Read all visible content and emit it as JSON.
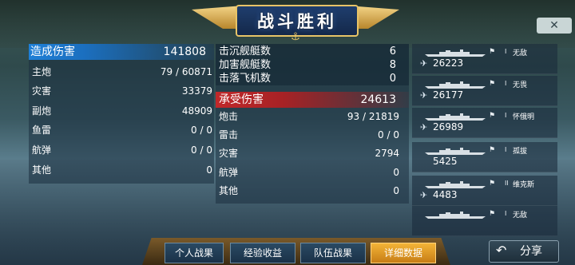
{
  "banner": {
    "title": "战斗胜利"
  },
  "close": {
    "symbol": "✕"
  },
  "damage_dealt": {
    "label": "造成伤害",
    "total": "141808",
    "rows": [
      {
        "label": "主炮",
        "value": "79 / 60871"
      },
      {
        "label": "灾害",
        "value": "33379"
      },
      {
        "label": "副炮",
        "value": "48909"
      },
      {
        "label": "鱼雷",
        "value": "0 / 0"
      },
      {
        "label": "航弹",
        "value": "0 / 0"
      },
      {
        "label": "其他",
        "value": "0"
      }
    ]
  },
  "kills": [
    {
      "label": "击沉舰艇数",
      "value": "6"
    },
    {
      "label": "加害舰艇数",
      "value": "8"
    },
    {
      "label": "击落飞机数",
      "value": "0"
    }
  ],
  "damage_received": {
    "label": "承受伤害",
    "total": "24613",
    "rows": [
      {
        "label": "炮击",
        "value": "93 / 21819"
      },
      {
        "label": "雷击",
        "value": "0 / 0"
      },
      {
        "label": "灾害",
        "value": "2794"
      },
      {
        "label": "航弹",
        "value": "0"
      },
      {
        "label": "其他",
        "value": "0"
      }
    ]
  },
  "ships": [
    {
      "name": "无敌",
      "rank": "I",
      "damage": "26223",
      "plane": true
    },
    {
      "name": "无畏",
      "rank": "I",
      "damage": "26177",
      "plane": true
    },
    {
      "name": "怀俄明",
      "rank": "I",
      "damage": "26989",
      "plane": true
    },
    {
      "name": "孤拔",
      "rank": "I",
      "damage": "5425",
      "plane": false
    },
    {
      "name": "维克斯",
      "rank": "II",
      "damage": "4483",
      "plane": true
    },
    {
      "name": "无敌",
      "rank": "I",
      "damage": "",
      "plane": false
    }
  ],
  "tabs": [
    {
      "label": "个人战果",
      "active": false
    },
    {
      "label": "经验收益",
      "active": false
    },
    {
      "label": "队伍战果",
      "active": false
    },
    {
      "label": "详细数据",
      "active": true
    }
  ],
  "share": {
    "label": "分享",
    "icon": "share-arrow-icon"
  },
  "colors": {
    "dealt": "#1e7fd6",
    "received": "#c0282a",
    "active_tab": "#f3b437"
  }
}
